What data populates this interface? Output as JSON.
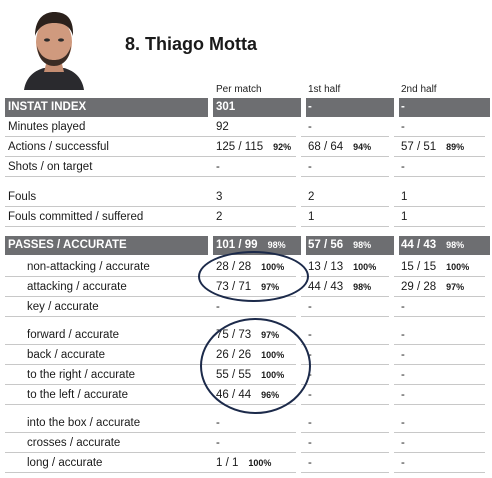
{
  "player": {
    "number_name": "8.  Thiago Motta"
  },
  "columns": [
    "Per match",
    "1st half",
    "2nd half"
  ],
  "rows": [
    {
      "label": "INSTAT INDEX",
      "dark": true,
      "cells": [
        {
          "v": "301",
          "p": ""
        },
        {
          "v": "-",
          "p": ""
        },
        {
          "v": "-",
          "p": ""
        }
      ]
    },
    {
      "label": "Minutes played",
      "cells": [
        {
          "v": "92",
          "p": ""
        },
        {
          "v": "-",
          "p": ""
        },
        {
          "v": "-",
          "p": ""
        }
      ]
    },
    {
      "label": "Actions / successful",
      "cells": [
        {
          "v": "125 / 115",
          "p": "92%"
        },
        {
          "v": "68 / 64",
          "p": "94%"
        },
        {
          "v": "57 / 51",
          "p": "89%"
        }
      ]
    },
    {
      "label": "Shots / on target",
      "cells": [
        {
          "v": "-",
          "p": ""
        },
        {
          "v": "-",
          "p": ""
        },
        {
          "v": "-",
          "p": ""
        }
      ]
    },
    {
      "label": "Fouls",
      "cells": [
        {
          "v": "3",
          "p": ""
        },
        {
          "v": "2",
          "p": ""
        },
        {
          "v": "1",
          "p": ""
        }
      ]
    },
    {
      "label": "Fouls committed / suffered",
      "cells": [
        {
          "v": "2",
          "p": ""
        },
        {
          "v": "1",
          "p": ""
        },
        {
          "v": "1",
          "p": ""
        }
      ]
    },
    {
      "label": "PASSES / ACCURATE",
      "dark": true,
      "cells": [
        {
          "v": "101 / 99",
          "p": "98%"
        },
        {
          "v": "57 / 56",
          "p": "98%"
        },
        {
          "v": "44 / 43",
          "p": "98%"
        }
      ]
    },
    {
      "label": "non-attacking / accurate",
      "indent": true,
      "cells": [
        {
          "v": "28 / 28",
          "p": "100%"
        },
        {
          "v": "13 / 13",
          "p": "100%"
        },
        {
          "v": "15 / 15",
          "p": "100%"
        }
      ]
    },
    {
      "label": "attacking / accurate",
      "indent": true,
      "cells": [
        {
          "v": "73 / 71",
          "p": "97%"
        },
        {
          "v": "44 / 43",
          "p": "98%"
        },
        {
          "v": "29 / 28",
          "p": "97%"
        }
      ]
    },
    {
      "label": "key / accurate",
      "indent": true,
      "cells": [
        {
          "v": "-",
          "p": ""
        },
        {
          "v": "-",
          "p": ""
        },
        {
          "v": "-",
          "p": ""
        }
      ]
    },
    {
      "label": "forward / accurate",
      "indent": true,
      "cells": [
        {
          "v": "75 / 73",
          "p": "97%"
        },
        {
          "v": "-",
          "p": ""
        },
        {
          "v": "-",
          "p": ""
        }
      ]
    },
    {
      "label": "back / accurate",
      "indent": true,
      "cells": [
        {
          "v": "26 / 26",
          "p": "100%"
        },
        {
          "v": "-",
          "p": ""
        },
        {
          "v": "-",
          "p": ""
        }
      ]
    },
    {
      "label": "to the right / accurate",
      "indent": true,
      "cells": [
        {
          "v": "55 / 55",
          "p": "100%"
        },
        {
          "v": "-",
          "p": ""
        },
        {
          "v": "-",
          "p": ""
        }
      ]
    },
    {
      "label": "to the left / accurate",
      "indent": true,
      "cells": [
        {
          "v": "46 / 44",
          "p": "96%"
        },
        {
          "v": "-",
          "p": ""
        },
        {
          "v": "-",
          "p": ""
        }
      ]
    },
    {
      "label": "into the box / accurate",
      "indent": true,
      "cells": [
        {
          "v": "-",
          "p": ""
        },
        {
          "v": "-",
          "p": ""
        },
        {
          "v": "-",
          "p": ""
        }
      ]
    },
    {
      "label": "crosses / accurate",
      "indent": true,
      "cells": [
        {
          "v": "-",
          "p": ""
        },
        {
          "v": "-",
          "p": ""
        },
        {
          "v": "-",
          "p": ""
        }
      ]
    },
    {
      "label": "long / accurate",
      "indent": true,
      "cells": [
        {
          "v": "1 / 1",
          "p": "100%"
        },
        {
          "v": "-",
          "p": ""
        },
        {
          "v": "-",
          "p": ""
        }
      ]
    }
  ]
}
